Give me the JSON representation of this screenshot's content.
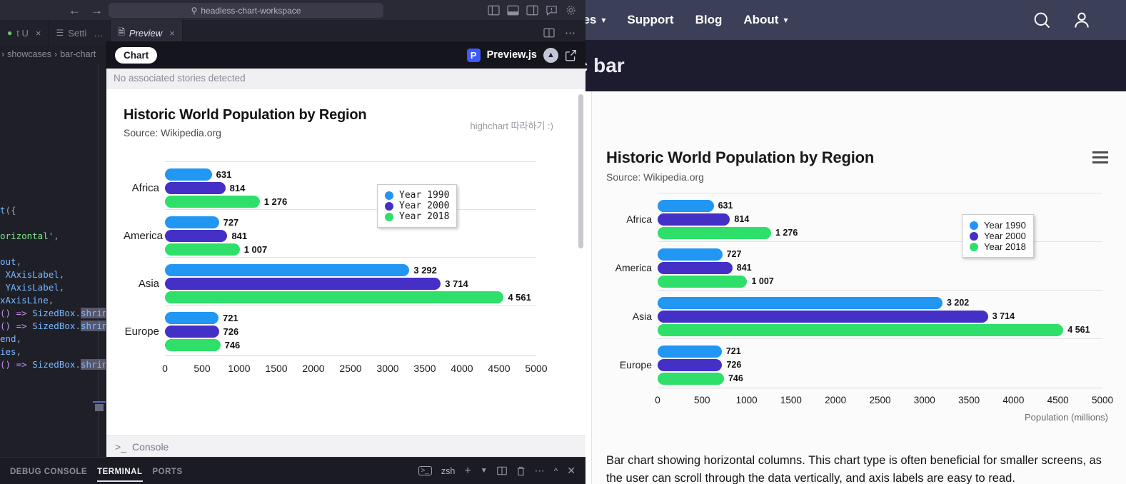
{
  "vscode": {
    "titlebar": {
      "back_icon": "arrow-left-icon",
      "forward_icon": "arrow-right-icon",
      "search_placeholder": "headless-chart-workspace",
      "search_icon": "search-icon",
      "icons": [
        "layout-panel-left-icon",
        "layout-panel-bottom-icon",
        "layout-panel-right-icon",
        "layout-panel-alert-icon",
        "gear-icon"
      ]
    },
    "tabs": [
      {
        "label": "t U",
        "icon": "file-icon",
        "close": "×",
        "active": false
      },
      {
        "label": "Setti",
        "icon": "settings-sliders-icon",
        "close": "…",
        "active": false
      },
      {
        "label": "Preview",
        "icon": "file-icon",
        "close": "×",
        "active": true
      }
    ],
    "tabbar_right": [
      "split-editor-icon",
      "more-actions-icon"
    ],
    "breadcrumb": [
      "showcases",
      "bar-chart"
    ],
    "code_lines": [
      "t({",
      "",
      "orizontal',",
      "",
      "out,",
      " XAxisLabel,",
      " YAxisLabel,",
      "xAxisLine,",
      "() => SizedBox.shrink",
      "() => SizedBox.shrink",
      "end,",
      "ies,",
      "() => SizedBox.shrink"
    ],
    "bottom_panel": {
      "tabs": [
        "DEBUG CONSOLE",
        "TERMINAL",
        "PORTS"
      ],
      "active_tab": "TERMINAL",
      "shell": "zsh",
      "shell_icon": "terminal-icon",
      "actions": [
        "new-terminal-icon",
        "chevron-down-icon",
        "split-terminal-icon",
        "trash-icon",
        "more-actions-icon",
        "chevron-up-icon",
        "close-icon"
      ]
    }
  },
  "preview": {
    "chip_label": "Chart",
    "brand_badge": "P",
    "brand_name": "Preview.js",
    "collapse_icon": "chevron-up-icon",
    "external_icon": "external-link-icon",
    "notice": "No associated stories detected",
    "console_label": "Console",
    "console_icon": "terminal-prompt-icon"
  },
  "website": {
    "nav_items": [
      {
        "label": "urces",
        "has_chevron": true
      },
      {
        "label": "Support",
        "has_chevron": false
      },
      {
        "label": "Blog",
        "has_chevron": false
      },
      {
        "label": "About",
        "has_chevron": true
      }
    ],
    "nav_icons": [
      "search-icon",
      "account-icon"
    ],
    "hero_title": "ic bar",
    "caption": "Bar chart showing horizontal columns. This chart type is often beneficial for smaller screens, as the user can scroll through the data vertically, and axis labels are easy to read.",
    "menu_icon": "hamburger-menu-icon"
  },
  "colors": {
    "series_1990": "#2196f3",
    "series_2000": "#4430c7",
    "series_2018": "#2ee06a",
    "nav_bg": "#3c3f58",
    "hero_bg": "#1d1b2e",
    "preview_header_bg": "#15151d"
  },
  "chart_data": [
    {
      "id": "preview-chart",
      "type": "bar",
      "orientation": "horizontal",
      "title": "Historic World Population by Region",
      "subtitle": "Source: Wikipedia.org",
      "annotation": "highchart 따라하기 :)",
      "categories": [
        "Africa",
        "America",
        "Asia",
        "Europe"
      ],
      "series": [
        {
          "name": "Year 1990",
          "color": "#2196f3",
          "values": [
            631,
            727,
            3292,
            721
          ],
          "labels": [
            "631",
            "727",
            "3 292",
            "721"
          ]
        },
        {
          "name": "Year 2000",
          "color": "#4430c7",
          "values": [
            814,
            841,
            3714,
            726
          ],
          "labels": [
            "814",
            "841",
            "3 714",
            "726"
          ]
        },
        {
          "name": "Year 2018",
          "color": "#2ee06a",
          "values": [
            1276,
            1007,
            4561,
            746
          ],
          "labels": [
            "1 276",
            "1 007",
            "4 561",
            "746"
          ]
        }
      ],
      "xticks": [
        "0",
        "500",
        "1000",
        "1500",
        "2000",
        "2500",
        "3000",
        "3500",
        "4000",
        "4500",
        "5000"
      ],
      "xlim": [
        0,
        5000
      ],
      "xlabel": "",
      "ylabel": "",
      "grid": true,
      "legend_position": "top-right"
    },
    {
      "id": "website-chart",
      "type": "bar",
      "orientation": "horizontal",
      "title": "Historic World Population by Region",
      "subtitle": "Source: Wikipedia.org",
      "categories": [
        "Africa",
        "America",
        "Asia",
        "Europe"
      ],
      "series": [
        {
          "name": "Year 1990",
          "color": "#2196f3",
          "values": [
            631,
            727,
            3202,
            721
          ],
          "labels": [
            "631",
            "727",
            "3 202",
            "721"
          ]
        },
        {
          "name": "Year 2000",
          "color": "#4430c7",
          "values": [
            814,
            841,
            3714,
            726
          ],
          "labels": [
            "814",
            "841",
            "3 714",
            "726"
          ]
        },
        {
          "name": "Year 2018",
          "color": "#2ee06a",
          "values": [
            1276,
            1007,
            4561,
            746
          ],
          "labels": [
            "1 276",
            "1 007",
            "4 561",
            "746"
          ]
        }
      ],
      "xticks": [
        "0",
        "500",
        "1000",
        "1500",
        "2000",
        "2500",
        "3000",
        "3500",
        "4000",
        "4500",
        "5000"
      ],
      "xlim": [
        0,
        5000
      ],
      "xlabel": "Population (millions)",
      "ylabel": "",
      "grid": true,
      "legend_position": "right"
    }
  ]
}
